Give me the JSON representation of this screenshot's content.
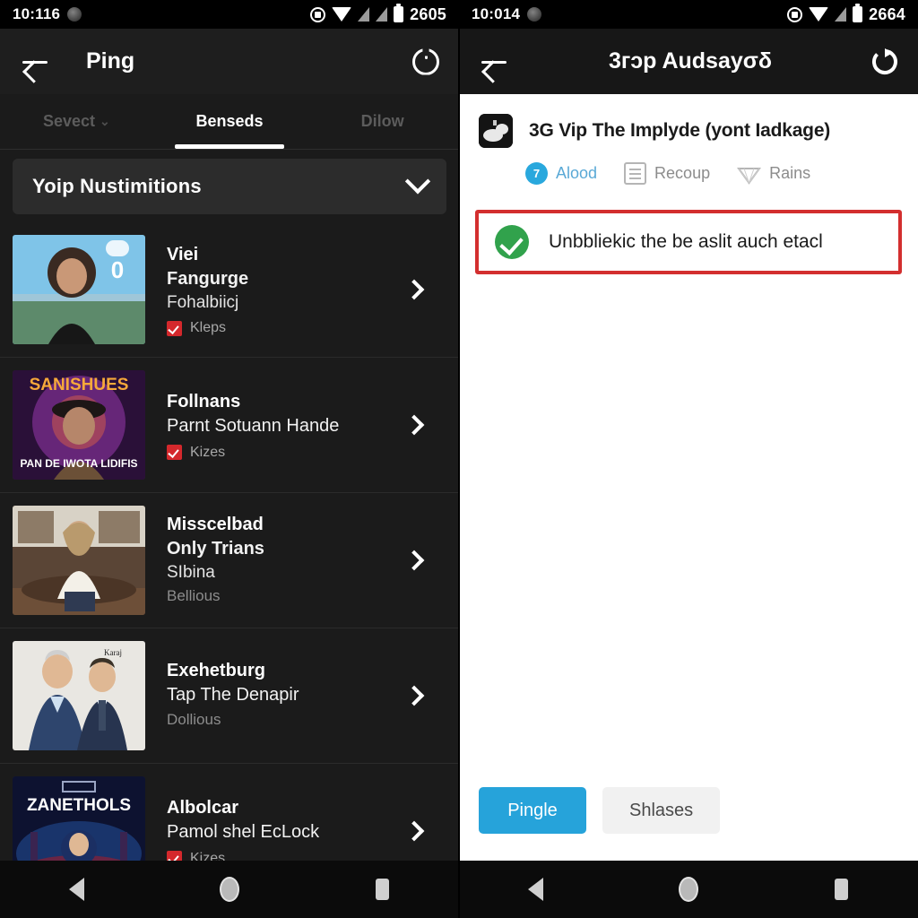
{
  "left": {
    "statusbar": {
      "clock": "10:116",
      "battery_number": "2605",
      "icons": [
        "notification-blob-icon",
        "alarm-icon",
        "wifi-icon",
        "signal-icon",
        "signal-icon-2",
        "battery-icon"
      ]
    },
    "appbar": {
      "title": "Ping",
      "back": "back-arrow",
      "action": "power-icon"
    },
    "tabs": [
      {
        "label": "Sevect",
        "caret": "⌄",
        "active": false,
        "muted": false
      },
      {
        "label": "Benseds",
        "caret": "",
        "active": true,
        "muted": false
      },
      {
        "label": "Dilow",
        "caret": "",
        "active": false,
        "muted": true
      }
    ],
    "group_header": {
      "title": "Yoip Nustimitions",
      "chevron": "chevron-down-icon"
    },
    "items": [
      {
        "line1": "Viei",
        "line2": "Fangurge",
        "line2_bold": true,
        "line3": "Fohalbiicj",
        "sub": "",
        "flag": "Kleps",
        "has_flag": true,
        "thumb": "portrait-woman-outdoor"
      },
      {
        "line1": "Follnans",
        "line2": "Parnt Sotuann Hande",
        "line2_bold": false,
        "line3": "",
        "sub": "",
        "flag": "Kizes",
        "has_flag": true,
        "thumb": "poster-sanishues"
      },
      {
        "line1": "Misscelbad",
        "line2": "Only Trians",
        "line2_bold": true,
        "line3": "SIbina",
        "sub": "Bellious",
        "flag": "",
        "has_flag": false,
        "thumb": "portrait-woman-indoor"
      },
      {
        "line1": "Exehetburg",
        "line2": "Tap The Denapir",
        "line2_bold": false,
        "line3": "",
        "sub": "Dollious",
        "flag": "",
        "has_flag": false,
        "thumb": "two-men-suits"
      },
      {
        "line1": "Albolcar",
        "line2": "Pamol shel EcLock",
        "line2_bold": false,
        "line3": "",
        "sub": "",
        "flag": "Kizes",
        "has_flag": true,
        "thumb": "poster-zanethols"
      }
    ],
    "navbar": {
      "back": "nav-back-icon",
      "home": "nav-home-icon",
      "recents": "nav-recents-icon"
    }
  },
  "right": {
    "statusbar": {
      "clock": "10:014",
      "battery_number": "2664"
    },
    "appbar": {
      "title": "3гɔp Audsaуσδ",
      "back": "back-arrow",
      "action": "refresh-icon"
    },
    "title_row": {
      "icon": "app-thumbnail-icon",
      "title": "3G Vip The Implуde (yont Iadkage)"
    },
    "meta": [
      {
        "label": "Alood",
        "icon": "badge-circle-icon",
        "badge": "7",
        "accent": true
      },
      {
        "label": "Recoup",
        "icon": "document-icon",
        "accent": false
      },
      {
        "label": "Rains",
        "icon": "diamond-icon",
        "accent": false
      }
    ],
    "alert": {
      "icon": "success-check-icon",
      "text": "Unbbliekic the be aslit auch etacl",
      "border_color": "#d32f2f"
    },
    "actions": [
      {
        "label": "Pingle",
        "style": "primary"
      },
      {
        "label": "Shlases",
        "style": "secondary"
      }
    ],
    "navbar": {
      "back": "nav-back-icon",
      "home": "nav-home-icon",
      "recents": "nav-recents-icon"
    }
  },
  "colors": {
    "accent_blue": "#26a3da",
    "alert_red": "#d32f2f",
    "success_green": "#31a24c",
    "flag_red": "#d4282c"
  }
}
